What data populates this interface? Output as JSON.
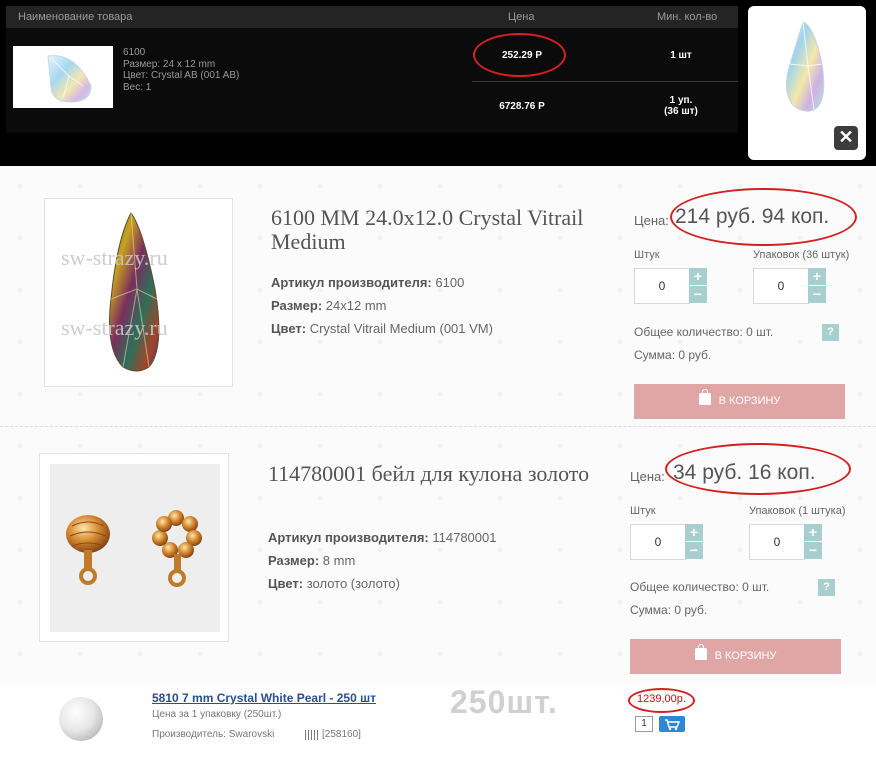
{
  "top_table": {
    "headers": {
      "name": "Наименование товара",
      "price": "Цена",
      "min_qty": "Мин. кол-во"
    },
    "product": {
      "code": "6100",
      "size": "Размер: 24 x 12 mm",
      "color": "Цвет: Crystal AB (001 AB)",
      "weight": "Вес: 1"
    },
    "rows": [
      {
        "price": "252.29 Р",
        "qty": "1 шт"
      },
      {
        "price": "6728.76 Р",
        "qty": "1 уп.",
        "qty_note": "(36 шт)"
      }
    ],
    "close_label": "✕"
  },
  "products": [
    {
      "title": "6100 MM 24.0x12.0 Crystal Vitrail Medium",
      "watermark": "sw-strazy.ru",
      "article_label": "Артикул производителя:",
      "article": "6100",
      "size_label": "Размер:",
      "size": "24x12 mm",
      "color_label": "Цвет:",
      "color": "Crystal Vitrail Medium (001 VM)",
      "price_label": "Цена:",
      "price": "214 руб. 94 коп.",
      "qty_label": "Штук",
      "pack_label": "Упаковок (36 штук)",
      "qty_value": "0",
      "pack_value": "0",
      "total_qty": "Общее количество: 0 шт.",
      "sum": "Сумма: 0 руб.",
      "cart": "В КОРЗИНУ"
    },
    {
      "title": "114780001 бейл для кулона золото",
      "article_label": "Артикул производителя:",
      "article": "114780001",
      "size_label": "Размер:",
      "size": "8 mm",
      "color_label": "Цвет:",
      "color": "золото (золото)",
      "price_label": "Цена:",
      "price": "34 руб. 16 коп.",
      "qty_label": "Штук",
      "pack_label": "Упаковок (1 штука)",
      "qty_value": "0",
      "pack_value": "0",
      "total_qty": "Общее количество: 0 шт.",
      "sum": "Сумма: 0 руб.",
      "cart": "В КОРЗИНУ"
    }
  ],
  "bottom_item": {
    "title": "5810 7 mm Crystal White Pearl - 250 шт",
    "per_pack": "Цена за 1 упаковку (250шт.)",
    "maker": "Производитель: Swarovski",
    "sku": "[258160]",
    "big_qty": "250шт.",
    "price": "1239,00р.",
    "qty": "1"
  },
  "colors": {
    "accent_teal": "#a8cfd0",
    "cart_pink": "#e0a6a6",
    "highlight_red": "#d42020",
    "link_blue": "#2a4f8a"
  }
}
